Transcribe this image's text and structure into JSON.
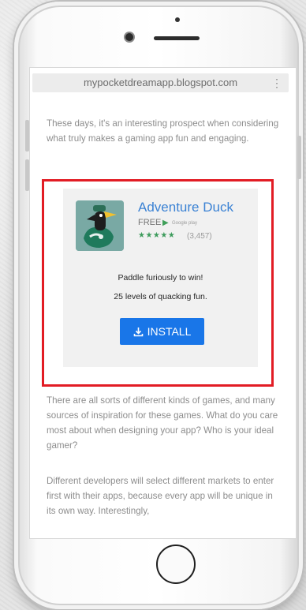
{
  "browser": {
    "url": "mypocketdreamapp.blogspot.com",
    "menu_icon": "more-vert-icon"
  },
  "article": {
    "paragraph_1": "These days, it's an interesting prospect when considering what truly makes a gaming app fun and engaging.",
    "paragraph_2": "There are all sorts of different kinds of games, and many sources of inspiration for these games. What do you care most about when designing your app? Who is your ideal gamer?",
    "paragraph_3": "Different developers will select different markets to enter first with their apps, because every app will be unique in its own way. Interestingly,"
  },
  "ad": {
    "app_name": "Adventure Duck",
    "price": "FREE",
    "store_label": "Google play",
    "stars": "★★★★★",
    "rating_count": "(3,457)",
    "tagline_1": "Paddle furiously to win!",
    "tagline_2": "25 levels of quacking fun.",
    "install_label": "INSTALL",
    "highlight_color": "#e21c24",
    "button_color": "#1976e8",
    "title_color": "#3b82d4"
  }
}
